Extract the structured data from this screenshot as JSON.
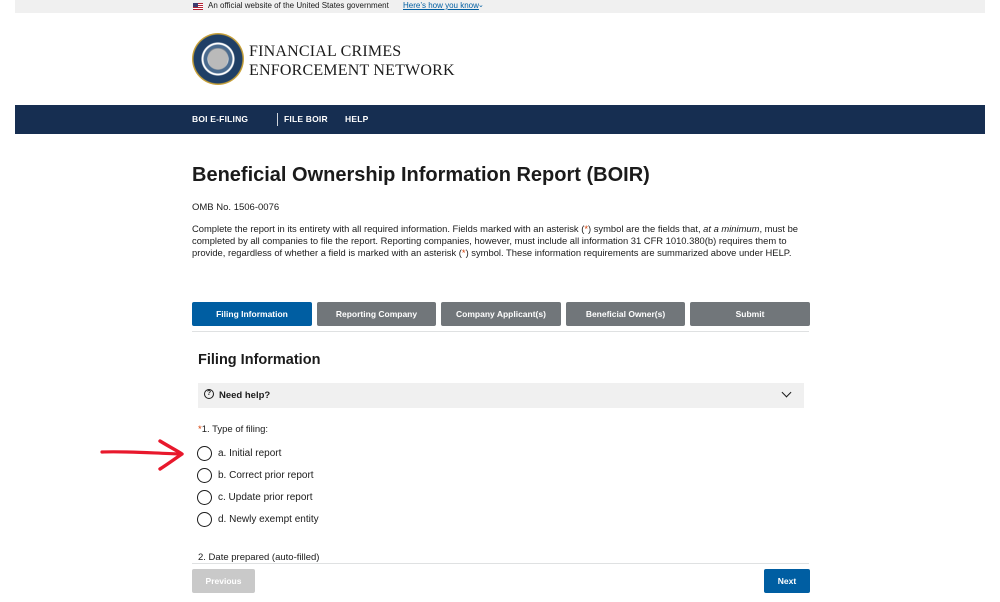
{
  "gov_banner": {
    "official_text": "An official website of the United States government",
    "how_you_know": "Here’s how you know"
  },
  "header": {
    "org_line1": "FINANCIAL CRIMES",
    "org_line2": "ENFORCEMENT NETWORK"
  },
  "nav": {
    "items": [
      {
        "label": "BOI E-FILING"
      },
      {
        "label": "FILE BOIR"
      },
      {
        "label": "HELP"
      }
    ]
  },
  "page": {
    "title": "Beneficial Ownership Information Report (BOIR)",
    "omb": "OMB No. 1506-0076",
    "intro_part1": "Complete the report in its entirety with all required information. Fields marked with an asterisk (",
    "intro_ast1": "*",
    "intro_part2": ") symbol are the fields that, ",
    "intro_em": "at a minimum",
    "intro_part3": ", must be completed by all companies to file the report. Reporting companies, however, must include all information 31 CFR 1010.380(b) requires them to provide, regardless of whether a field is marked with an asterisk (",
    "intro_ast2": "*",
    "intro_part4": ") symbol. These information requirements are summarized above under HELP."
  },
  "steps": [
    {
      "label": "Filing Information",
      "active": true
    },
    {
      "label": "Reporting Company",
      "active": false
    },
    {
      "label": "Company Applicant(s)",
      "active": false
    },
    {
      "label": "Beneficial Owner(s)",
      "active": false
    },
    {
      "label": "Submit",
      "active": false
    }
  ],
  "section": {
    "title": "Filing Information",
    "help_label": "Need help?",
    "question1": {
      "required_mark": "*",
      "label": "1. Type of filing:",
      "options": [
        {
          "label": "a. Initial report",
          "selected": false
        },
        {
          "label": "b. Correct prior report",
          "selected": false
        },
        {
          "label": "c. Update prior report",
          "selected": false
        },
        {
          "label": "d. Newly exempt entity",
          "selected": false
        }
      ]
    },
    "question2_label": "2. Date prepared (auto-filled)"
  },
  "footer_buttons": {
    "previous": "Previous",
    "next": "Next"
  },
  "colors": {
    "nav_bg": "#162e51",
    "primary": "#005ea2",
    "inactive_step": "#71767a",
    "required": "#d63e04",
    "arrow": "#e8182c"
  }
}
